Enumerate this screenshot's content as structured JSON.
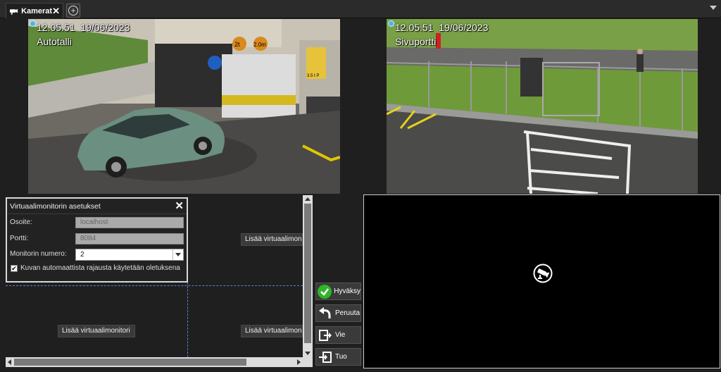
{
  "tabs": [
    {
      "label": "Kamerat",
      "close": "✕"
    }
  ],
  "add_tab_symbol": "+",
  "cameras": [
    {
      "time": "12.05.51",
      "date": "19/06/2023",
      "name": "Autotalli"
    },
    {
      "time": "12.05.51",
      "date": "19/06/2023",
      "name": "Sivuportti"
    }
  ],
  "garage_signs": {
    "sign1": "2t",
    "sign2": "2.0m",
    "sign3": "3.5 t P"
  },
  "settings_panel": {
    "title": "Virtuaalimonitorin asetukset",
    "close": "✕",
    "address_label": "Osoite:",
    "address_value": "localhost",
    "port_label": "Portti:",
    "port_value": "8084",
    "monitor_number_label": "Monitorin numero:",
    "monitor_number_value": "2",
    "auto_crop_label": "Kuvan automaattista rajausta käytetään oletuksena",
    "auto_crop_checked": true,
    "checkmark": "✔"
  },
  "add_monitor_buttons": [
    "Lisää virtuaalimonitori",
    "Lisää virtuaalimonitori",
    "Lisää virtuaalimonitori"
  ],
  "actions": {
    "accept": "Hyväksy",
    "cancel": "Peruuta",
    "export": "Vie",
    "import": "Tuo"
  },
  "colors": {
    "accept_green": "#2fb52a",
    "status_dot": "#4fb3e8",
    "dashed_border": "#5b7fd6"
  },
  "icons": {
    "tab": "camera-icon",
    "monitor_placeholder": "camera-icon"
  }
}
